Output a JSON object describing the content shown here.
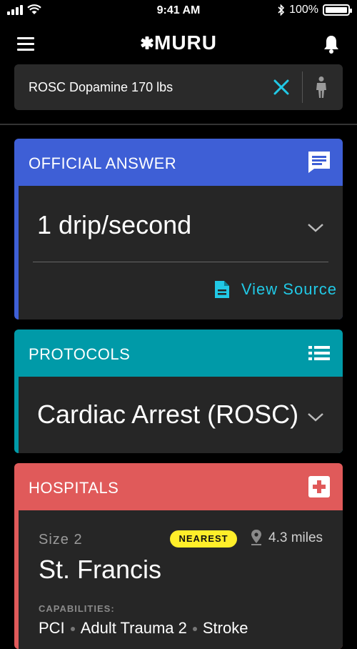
{
  "status_bar": {
    "time": "9:41 AM",
    "battery": "100%"
  },
  "header": {
    "brand": "MURU"
  },
  "search": {
    "query": "ROSC Dopamine 170 lbs"
  },
  "official_answer": {
    "title": "OFFICIAL ANSWER",
    "answer": "1 drip/second",
    "view_source": "View Source"
  },
  "protocols": {
    "title": "PROTOCOLS",
    "protocol": "Cardiac Arrest (ROSC)"
  },
  "hospitals": {
    "title": "HOSPITALS",
    "size": "Size 2",
    "badge": "NEAREST",
    "distance": "4.3 miles",
    "name": "St. Francis",
    "capabilities_label": "CAPABILITIES:",
    "capabilities": [
      "PCI",
      "Adult Trauma 2",
      "Stroke"
    ]
  },
  "colors": {
    "official": "#3e5fd6",
    "protocols": "#009aa8",
    "hospitals": "#e05a5a",
    "accent": "#21c9e6",
    "badge": "#ffee2a"
  }
}
